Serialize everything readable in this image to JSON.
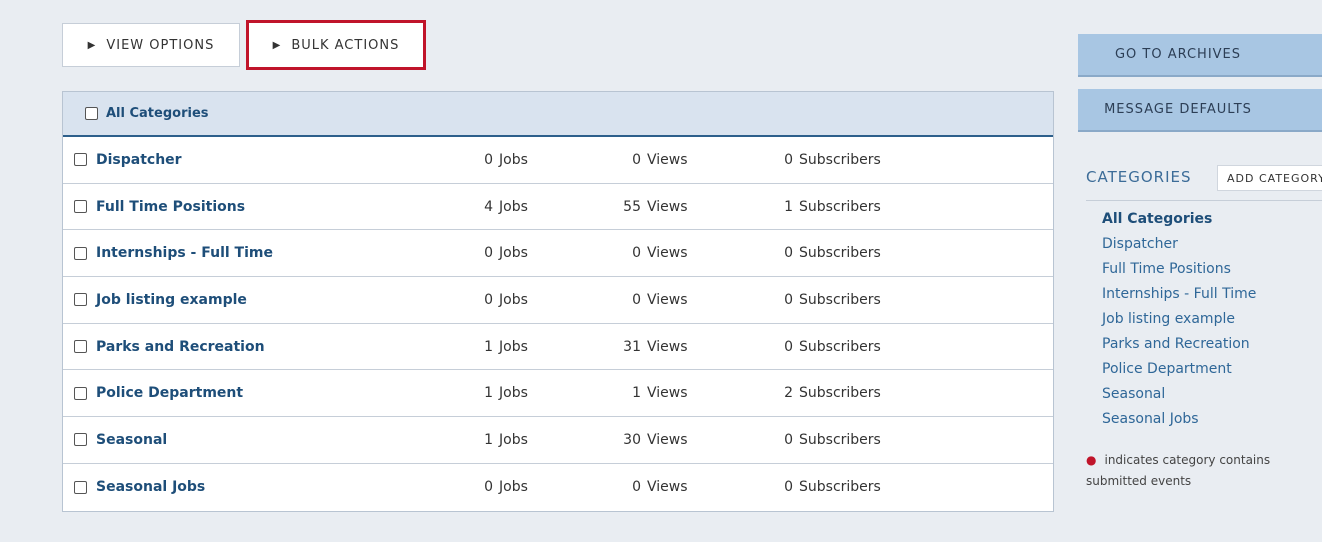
{
  "toolbar": {
    "view_options": "VIEW OPTIONS",
    "bulk_actions": "BULK ACTIONS",
    "triangle": "▶"
  },
  "table": {
    "header_label": "All Categories",
    "rows": [
      {
        "name": "Dispatcher",
        "jobs": "0",
        "views": "0",
        "subscribers": "0"
      },
      {
        "name": "Full Time Positions",
        "jobs": "4",
        "views": "55",
        "subscribers": "1"
      },
      {
        "name": "Internships - Full Time",
        "jobs": "0",
        "views": "0",
        "subscribers": "0"
      },
      {
        "name": "Job listing example",
        "jobs": "0",
        "views": "0",
        "subscribers": "0"
      },
      {
        "name": "Parks and Recreation",
        "jobs": "1",
        "views": "31",
        "subscribers": "0"
      },
      {
        "name": "Police Department",
        "jobs": "1",
        "views": "1",
        "subscribers": "2"
      },
      {
        "name": "Seasonal",
        "jobs": "1",
        "views": "30",
        "subscribers": "0"
      },
      {
        "name": "Seasonal Jobs",
        "jobs": "0",
        "views": "0",
        "subscribers": "0"
      }
    ],
    "units": {
      "jobs": "Jobs",
      "views": "Views",
      "subscribers": "Subscribers"
    }
  },
  "sidebar": {
    "go_to_archives": "GO TO ARCHIVES",
    "message_defaults": "MESSAGE DEFAULTS",
    "categories_heading": "CATEGORIES",
    "add_category": "ADD CATEGORY",
    "items": [
      "All Categories",
      "Dispatcher",
      "Full Time Positions",
      "Internships - Full Time",
      "Job listing example",
      "Parks and Recreation",
      "Police Department",
      "Seasonal",
      "Seasonal Jobs"
    ],
    "note_text": "indicates category contains submitted events"
  },
  "colors": {
    "accent": "#1e4e79",
    "highlight_border": "#c0142a",
    "button_blue": "#a8c6e3"
  }
}
